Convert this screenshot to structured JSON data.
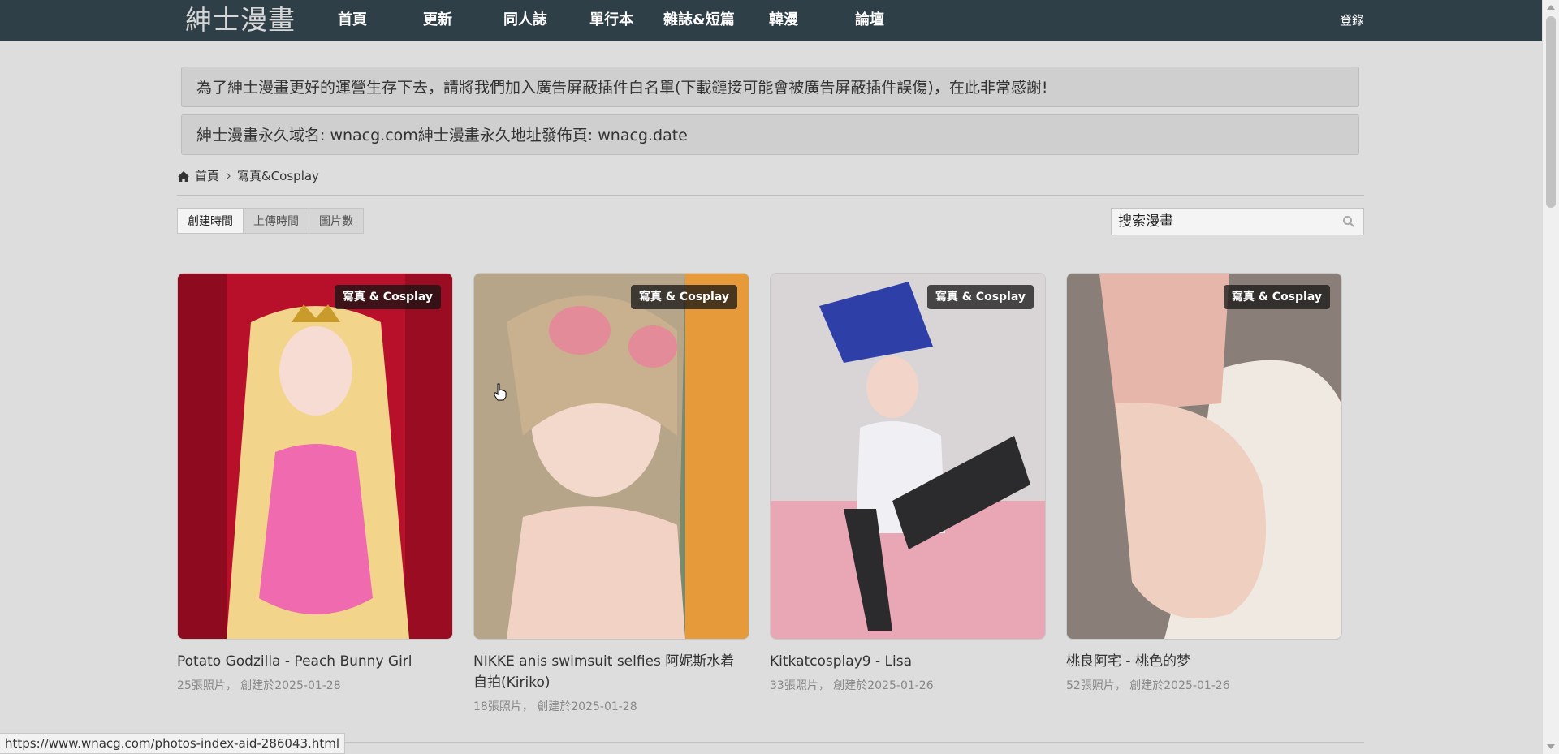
{
  "header": {
    "logo": "紳士漫畫",
    "nav": [
      "首頁",
      "更新",
      "同人誌",
      "單行本",
      "雜誌&短篇",
      "韓漫",
      "論壇"
    ],
    "login": "登錄"
  },
  "notices": [
    "為了紳士漫畫更好的運營生存下去，請將我們加入廣告屏蔽插件白名單(下載鏈接可能會被廣告屏蔽插件誤傷)，在此非常感謝!",
    "紳士漫畫永久域名: wnacg.com紳士漫畫永久地址發佈頁: wnacg.date"
  ],
  "breadcrumb": {
    "home": "首頁",
    "separator": ">",
    "current": "寫真&Cosplay"
  },
  "sort": {
    "options": [
      "創建時間",
      "上傳時間",
      "圖片數"
    ],
    "active": "創建時間"
  },
  "search": {
    "value": "搜索漫畫"
  },
  "cards": [
    {
      "tag": "寫真 & Cosplay",
      "title": "Potato Godzilla - Peach Bunny Girl",
      "info": "25張照片， 創建於2025-01-28"
    },
    {
      "tag": "寫真 & Cosplay",
      "title": "NIKKE anis swimsuit selfies 阿妮斯水着自拍(Kiriko)",
      "info": "18張照片， 創建於2025-01-28"
    },
    {
      "tag": "寫真 & Cosplay",
      "title": "Kitkatcosplay9 - Lisa",
      "info": "33張照片， 創建於2025-01-26"
    },
    {
      "tag": "寫真 & Cosplay",
      "title": "桃良阿宅 - 桃色的梦",
      "info": "52張照片， 創建於2025-01-26"
    }
  ],
  "statusbar": {
    "url": "https://www.wnacg.com/photos-index-aid-286043.html"
  }
}
